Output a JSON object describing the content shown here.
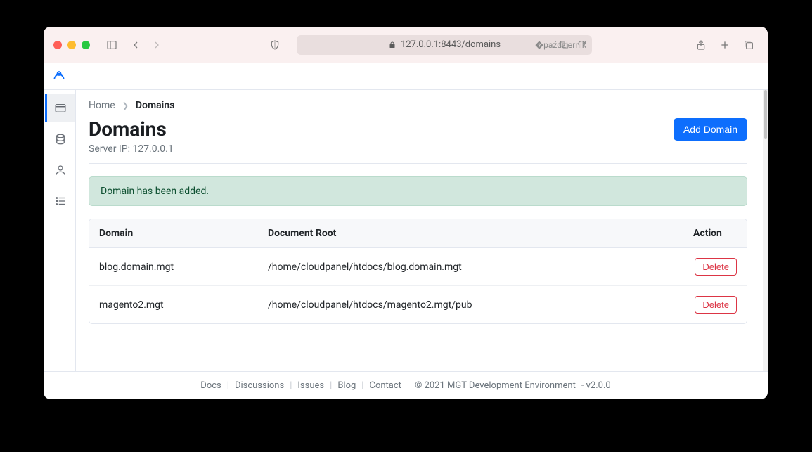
{
  "browser": {
    "url": "127.0.0.1:8443/domains"
  },
  "breadcrumb": {
    "home": "Home",
    "current": "Domains"
  },
  "header": {
    "title": "Domains",
    "server_ip_label": "Server IP:",
    "server_ip": "127.0.0.1",
    "add_button": "Add Domain"
  },
  "alert": {
    "message": "Domain has been added."
  },
  "table": {
    "columns": {
      "domain": "Domain",
      "docroot": "Document Root",
      "action": "Action"
    },
    "rows": [
      {
        "domain": "blog.domain.mgt",
        "docroot": "/home/cloudpanel/htdocs/blog.domain.mgt",
        "delete": "Delete"
      },
      {
        "domain": "magento2.mgt",
        "docroot": "/home/cloudpanel/htdocs/magento2.mgt/pub",
        "delete": "Delete"
      }
    ]
  },
  "footer": {
    "links": {
      "docs": "Docs",
      "discussions": "Discussions",
      "issues": "Issues",
      "blog": "Blog",
      "contact": "Contact"
    },
    "copyright": "© 2021 MGT Development Environment",
    "version": "- v2.0.0"
  }
}
